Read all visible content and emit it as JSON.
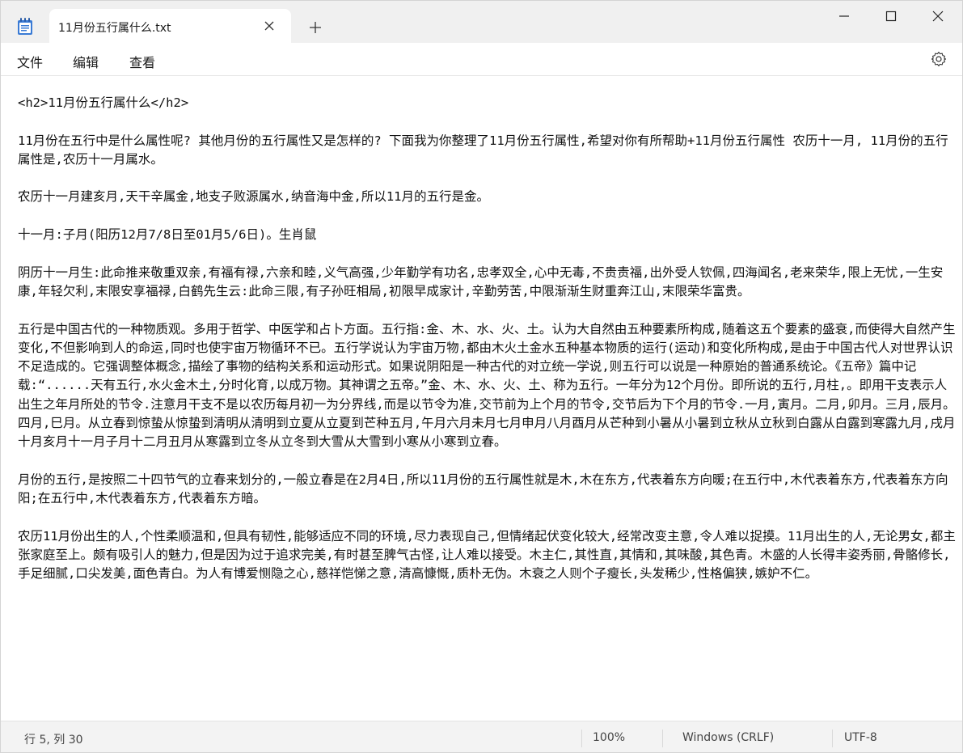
{
  "window": {
    "tab_title": "11月份五行属什么.txt",
    "colors": {
      "accent": "#0067c0",
      "icon_blue": "#3a7bd5"
    }
  },
  "menu": {
    "file": "文件",
    "edit": "编辑",
    "view": "查看"
  },
  "icons": {
    "app": "notepad-icon",
    "close_tab": "close-icon",
    "new_tab": "plus-icon",
    "minimize": "minimize-icon",
    "maximize": "maximize-icon",
    "close_window": "close-icon",
    "settings": "gear-icon"
  },
  "document": {
    "paragraphs": [
      "<h2>11月份五行属什么</h2>",
      "11月份在五行中是什么属性呢? 其他月份的五行属性又是怎样的? 下面我为你整理了11月份五行属性,希望对你有所帮助+11月份五行属性 农历十一月, 11月份的五行属性是,农历十一月属水。",
      "农历十一月建亥月,天干辛属金,地支子败源属水,纳音海中金,所以11月的五行是金。",
      "十一月:子月(阳历12月7/8日至01月5/6日)。生肖鼠",
      "阴历十一月生:此命推来敬重双亲,有福有禄,六亲和睦,义气高强,少年勤学有功名,忠孝双全,心中无毒,不贵责福,出外受人钦佩,四海闻名,老来荣华,限上无忧,一生安康,年轻欠利,末限安享福禄,白鹤先生云:此命三限,有子孙旺相局,初限早成家计,辛勤劳苦,中限渐渐生财重奔江山,末限荣华富贵。",
      "五行是中国古代的一种物质观。多用于哲学、中医学和占卜方面。五行指:金、木、水、火、土。认为大自然由五种要素所构成,随着这五个要素的盛衰,而使得大自然产生变化,不但影响到人的命运,同时也使宇宙万物循环不已。五行学说认为宇宙万物,都由木火土金水五种基本物质的运行(运动)和变化所构成,是由于中国古代人对世界认识不足造成的。它强调整体概念,描绘了事物的结构关系和运动形式。如果说阴阳是一种古代的对立统一学说,则五行可以说是一种原始的普通系统论。《五帝》篇中记载:“......天有五行,水火金木土,分时化育,以成万物。其神谓之五帝。”金、木、水、火、土、称为五行。一年分为12个月份。即所说的五行,月柱,。即用干支表示人出生之年月所处的节令.注意月干支不是以农历每月初一为分界线,而是以节令为准,交节前为上个月的节令,交节后为下个月的节令.一月,寅月。二月,卯月。三月,辰月。四月,巳月。从立春到惊蛰从惊蛰到清明从清明到立夏从立夏到芒种五月,午月六月未月七月申月八月酉月从芒种到小暑从小暑到立秋从立秋到白露从白露到寒露九月,戌月十月亥月十一月子月十二月丑月从寒露到立冬从立冬到大雪从大雪到小寒从小寒到立春。",
      "月份的五行,是按照二十四节气的立春来划分的,一般立春是在2月4日,所以11月份的五行属性就是木,木在东方,代表着东方向暖;在五行中,木代表着东方,代表着东方向阳;在五行中,木代表着东方,代表着东方暗。",
      "农历11月份出生的人,个性柔顺温和,但具有韧性,能够适应不同的环境,尽力表现自己,但情绪起伏变化较大,经常改变主意,令人难以捉摸。11月出生的人,无论男女,都主张家庭至上。颇有吸引人的魅力,但是因为过于追求完美,有时甚至脾气古怪,让人难以接受。木主仁,其性直,其情和,其味酸,其色青。木盛的人长得丰姿秀丽,骨骼修长,手足细腻,口尖发美,面色青白。为人有博爱恻隐之心,慈祥恺悌之意,清高慷慨,质朴无伪。木衰之人则个子瘦长,头发稀少,性格偏狭,嫉妒不仁。"
    ]
  },
  "status": {
    "position": "行 5, 列 30",
    "zoom": "100%",
    "line_ending": "Windows (CRLF)",
    "encoding": "UTF-8"
  }
}
